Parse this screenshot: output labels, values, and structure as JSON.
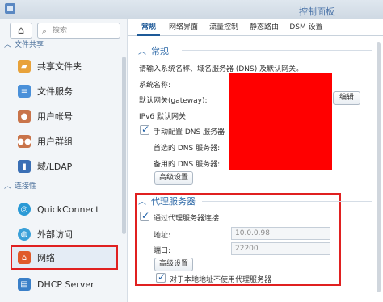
{
  "window": {
    "title": "控制面板"
  },
  "sidebar": {
    "search_placeholder": "搜索",
    "sections": {
      "file_sharing": "文件共享",
      "connectivity": "连接性"
    },
    "items": [
      {
        "label": "共享文件夹",
        "icon": "folder-share-icon",
        "color": "#e8a23a"
      },
      {
        "label": "文件服务",
        "icon": "file-services-icon",
        "color": "#4a90d9"
      },
      {
        "label": "用户帐号",
        "icon": "user-icon",
        "color": "#c9744a"
      },
      {
        "label": "用户群组",
        "icon": "group-icon",
        "color": "#c9744a"
      },
      {
        "label": "域/LDAP",
        "icon": "domain-icon",
        "color": "#3a6fb5"
      },
      {
        "label": "QuickConnect",
        "icon": "quickconnect-icon",
        "color": "#2a9ad6"
      },
      {
        "label": "外部访问",
        "icon": "globe-icon",
        "color": "#3aa0d8"
      },
      {
        "label": "网络",
        "icon": "network-house-icon",
        "color": "#e05a2a"
      },
      {
        "label": "DHCP Server",
        "icon": "dhcp-icon",
        "color": "#3a7fc8"
      }
    ],
    "active_item": "网络"
  },
  "tabs": [
    "常规",
    "网络界面",
    "流量控制",
    "静态路由",
    "DSM 设置"
  ],
  "general": {
    "title": "常规",
    "description": "请输入系统名称、域名服务器 (DNS) 及默认网关。",
    "system_name_label": "系统名称:",
    "gateway_label": "默认网关(gateway):",
    "edit_button": "编辑",
    "ipv6_gateway_label": "IPv6 默认网关:",
    "manual_dns_label": "手动配置 DNS 服务器",
    "manual_dns_checked": true,
    "preferred_dns_label": "首选的 DNS 服务器:",
    "alternate_dns_label": "备用的 DNS 服务器:",
    "advanced_button": "高级设置"
  },
  "proxy": {
    "title": "代理服务器",
    "connect_via_proxy_label": "通过代理服务器连接",
    "connect_via_proxy_checked": true,
    "address_label": "地址:",
    "address_value": "10.0.0.98",
    "port_label": "端口:",
    "port_value": "22200",
    "advanced_button": "高级设置",
    "bypass_local_label": "对于本地地址不使用代理服务器",
    "bypass_local_checked": true
  },
  "colors": {
    "accent": "#1e5a98",
    "highlight_border": "#e02020",
    "redaction": "#ff0000"
  }
}
